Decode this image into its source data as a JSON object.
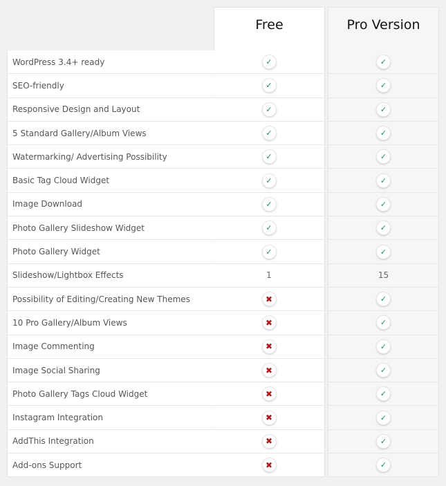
{
  "columns": {
    "free": "Free",
    "pro": "Pro Version"
  },
  "icons": {
    "yes": "check-icon",
    "no": "cross-icon",
    "yes_glyph": "✓",
    "no_glyph": "✖"
  },
  "colors": {
    "check": "#1e8a5a",
    "cross": "#b01a1a"
  },
  "rows": [
    {
      "feature": "WordPress 3.4+ ready",
      "free": "yes",
      "pro": "yes"
    },
    {
      "feature": "SEO-friendly",
      "free": "yes",
      "pro": "yes"
    },
    {
      "feature": "Responsive Design and Layout",
      "free": "yes",
      "pro": "yes"
    },
    {
      "feature": "5 Standard Gallery/Album Views",
      "free": "yes",
      "pro": "yes"
    },
    {
      "feature": "Watermarking/ Advertising Possibility",
      "free": "yes",
      "pro": "yes"
    },
    {
      "feature": "Basic Tag Cloud Widget",
      "free": "yes",
      "pro": "yes"
    },
    {
      "feature": "Image Download",
      "free": "yes",
      "pro": "yes"
    },
    {
      "feature": "Photo Gallery Slideshow Widget",
      "free": "yes",
      "pro": "yes"
    },
    {
      "feature": "Photo Gallery Widget",
      "free": "yes",
      "pro": "yes"
    },
    {
      "feature": "Slideshow/Lightbox Effects",
      "free": "1",
      "pro": "15"
    },
    {
      "feature": "Possibility of Editing/Creating New Themes",
      "free": "no",
      "pro": "yes"
    },
    {
      "feature": "10 Pro Gallery/Album Views",
      "free": "no",
      "pro": "yes"
    },
    {
      "feature": "Image Commenting",
      "free": "no",
      "pro": "yes"
    },
    {
      "feature": "Image Social Sharing",
      "free": "no",
      "pro": "yes"
    },
    {
      "feature": "Photo Gallery Tags Cloud Widget",
      "free": "no",
      "pro": "yes"
    },
    {
      "feature": "Instagram Integration",
      "free": "no",
      "pro": "yes"
    },
    {
      "feature": "AddThis Integration",
      "free": "no",
      "pro": "yes"
    },
    {
      "feature": "Add-ons Support",
      "free": "no",
      "pro": "yes"
    }
  ]
}
